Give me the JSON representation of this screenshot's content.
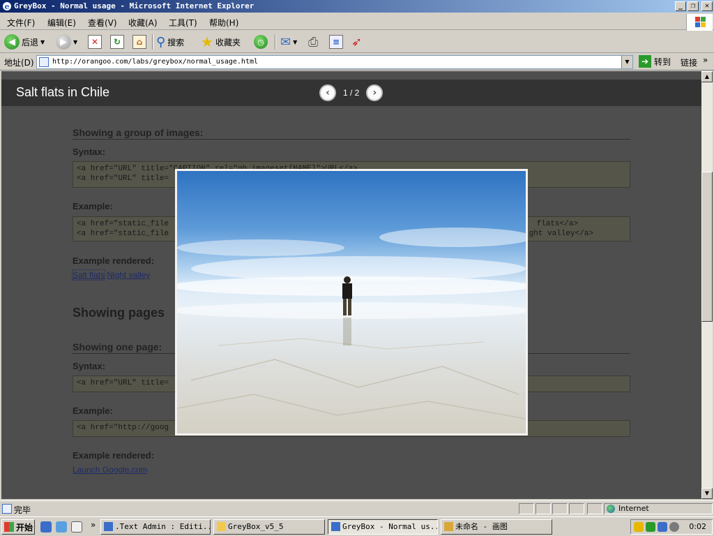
{
  "window": {
    "title": "GreyBox - Normal usage - Microsoft Internet Explorer",
    "buttons": [
      "_",
      "❐",
      "✕"
    ]
  },
  "menu": {
    "items": [
      "文件(F)",
      "编辑(E)",
      "查看(V)",
      "收藏(A)",
      "工具(T)",
      "帮助(H)"
    ]
  },
  "toolbar": {
    "back_label": "后退",
    "search_label": "搜索",
    "favorites_label": "收藏夹"
  },
  "address": {
    "label": "地址(D)",
    "url": "http://orangoo.com/labs/greybox/normal_usage.html",
    "go_label": "转到",
    "links_label": "链接"
  },
  "greybox": {
    "title": "Salt flats in Chile",
    "counter": "1 / 2",
    "prev": "‹",
    "next": "›"
  },
  "page": {
    "group_heading": "Showing a group of images:",
    "syntax_label": "Syntax:",
    "syntax_lines": [
      "<a href=\"URL\" title=\"CAPTION\" rel=\"gb_imageset[NAME]\">URL</a>",
      "<a href=\"URL\" title="
    ],
    "example_label": "Example:",
    "example_lines_left": [
      "<a href=\"static_file",
      "<a href=\"static_file"
    ],
    "example_lines_right": [
      "flats</a>",
      "ght valley</a>"
    ],
    "rendered_label": "Example rendered:",
    "rendered_links": [
      "Salt flats",
      "Night valley"
    ],
    "pages_heading": "Showing pages",
    "one_page_heading": "Showing one page:",
    "syntax2_label": "Syntax:",
    "syntax2_line": "<a href=\"URL\" title=",
    "example2_label": "Example:",
    "example2_line": "<a href=\"http://goog",
    "rendered2_label": "Example rendered:",
    "rendered2_link": "Launch Google.com"
  },
  "status": {
    "text": "完毕",
    "zone": "Internet"
  },
  "taskbar": {
    "start": "开始",
    "tasks": [
      ".Text Admin : Editi...",
      "GreyBox_v5_5",
      "GreyBox - Normal us...",
      "未命名 - 画图"
    ],
    "clock": "0:02"
  },
  "colors": {
    "overlay": "#4e4e4e",
    "header": "#333333",
    "title_bar": "#0a246a"
  }
}
